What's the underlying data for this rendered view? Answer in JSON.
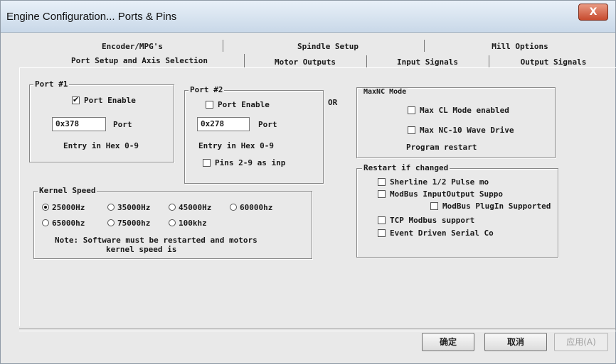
{
  "window": {
    "title": "Engine Configuration... Ports & Pins",
    "close_label": "X"
  },
  "tabs": {
    "row1": [
      "Encoder/MPG's",
      "Spindle Setup",
      "Mill Options"
    ],
    "row2": [
      "Port Setup and Axis Selection",
      "Motor Outputs",
      "Input Signals",
      "Output Signals"
    ],
    "active": "Port Setup and Axis Selection"
  },
  "port1": {
    "title": "Port #1",
    "enable_label": "Port Enable",
    "enabled": true,
    "address": "0x378",
    "port_label": "Port",
    "hint": "Entry in Hex 0-9"
  },
  "port2": {
    "title": "Port #2",
    "enable_label": "Port Enable",
    "enabled": false,
    "address": "0x278",
    "port_label": "Port",
    "hint": "Entry in Hex 0-9",
    "pins_label": "Pins 2-9 as inp",
    "pins_checked": false
  },
  "or_label": "OR",
  "maxnc": {
    "title": "MaxNC Mode",
    "cl_mode_label": "Max CL Mode enabled",
    "cl_mode_checked": false,
    "wave_label": "Max NC-10 Wave Drive",
    "wave_checked": false,
    "note": "Program restart"
  },
  "restart": {
    "title": "Restart if changed",
    "options": [
      {
        "label": "Sherline 1/2 Pulse mo",
        "checked": false
      },
      {
        "label": "ModBus InputOutput Suppo",
        "checked": false
      },
      {
        "label": "ModBus PlugIn Supported",
        "checked": false
      },
      {
        "label": "TCP Modbus support",
        "checked": false
      },
      {
        "label": "Event Driven Serial Co",
        "checked": false
      }
    ]
  },
  "kernel": {
    "title": "Kernel Speed",
    "options": [
      {
        "label": "25000Hz",
        "checked": true
      },
      {
        "label": "35000Hz",
        "checked": false
      },
      {
        "label": "45000Hz",
        "checked": false
      },
      {
        "label": "60000hz",
        "checked": false
      },
      {
        "label": "65000hz",
        "checked": false
      },
      {
        "label": "75000hz",
        "checked": false
      },
      {
        "label": "100khz",
        "checked": false
      }
    ],
    "note_line1": "Note: Software must be restarted and motors",
    "note_line2": "kernel speed is"
  },
  "buttons": {
    "ok": "确定",
    "cancel": "取消",
    "apply": "应用(A)"
  }
}
